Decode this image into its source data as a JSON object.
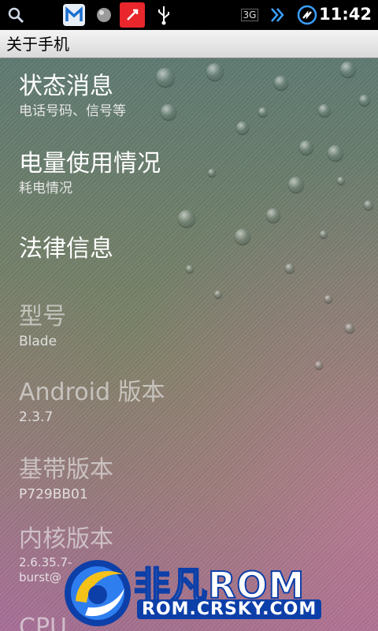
{
  "status_bar": {
    "time": "11:42",
    "network": "3G",
    "icons": [
      "search-icon",
      "app-m-icon",
      "ball-icon",
      "flash-app-icon",
      "usb-icon",
      "network-3g-icon",
      "data-arrows-icon",
      "sync-icon"
    ]
  },
  "title": "关于手机",
  "items": [
    {
      "title": "状态消息",
      "subtitle": "电话号码、信号等",
      "enabled": true
    },
    {
      "title": "电量使用情况",
      "subtitle": "耗电情况",
      "enabled": true
    },
    {
      "title": "法律信息",
      "subtitle": "",
      "enabled": true
    },
    {
      "title": "型号",
      "subtitle": "Blade",
      "enabled": false
    },
    {
      "title": "Android 版本",
      "subtitle": "2.3.7",
      "enabled": false
    },
    {
      "title": "基带版本",
      "subtitle": "P729BB01",
      "enabled": false
    },
    {
      "title": "内核版本",
      "subtitle_line1": "2.6.35.7-",
      "subtitle_line2": "burst@",
      "enabled": false
    },
    {
      "title": "CPU",
      "enabled": false
    }
  ],
  "watermark": {
    "brand": "非凡ROM",
    "url": "ROM.CRSKY.COM"
  },
  "colors": {
    "status_bar": "#000000",
    "title_bar": "#e8e8e8",
    "watermark_green": "#4caf1a",
    "watermark_blue": "#1a5bd0"
  }
}
